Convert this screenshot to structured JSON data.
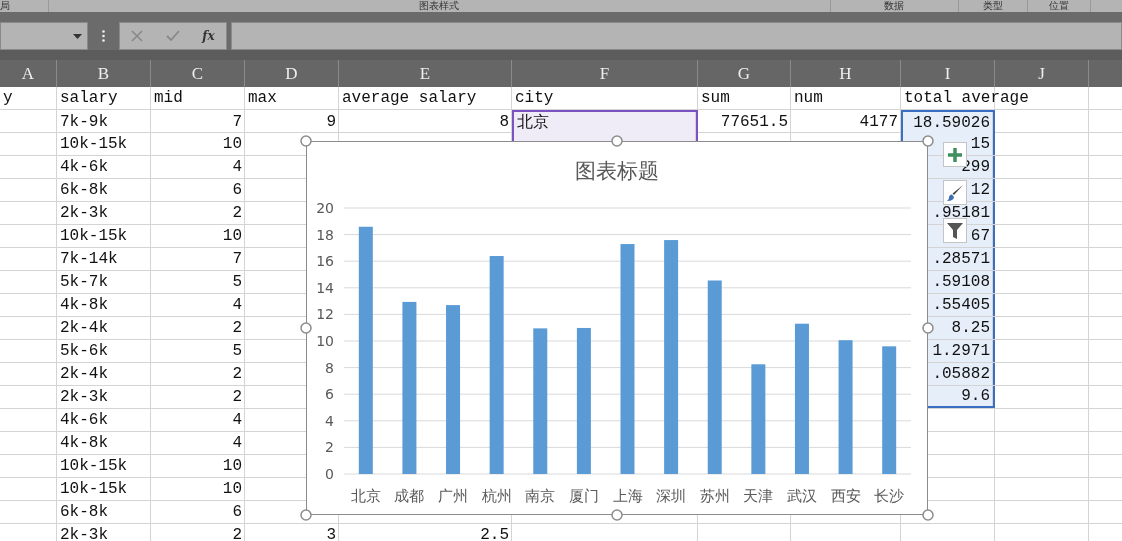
{
  "ribbon_groups": [
    {
      "label": "局"
    },
    {
      "label": "图表样式"
    },
    {
      "label": "数据"
    },
    {
      "label": "类型"
    },
    {
      "label": "位置"
    }
  ],
  "formula_bar": {
    "function_label": "fx"
  },
  "column_letters": [
    "A",
    "B",
    "C",
    "D",
    "E",
    "F",
    "G",
    "H",
    "I",
    "J"
  ],
  "header_row": [
    "y",
    "salary",
    "mid",
    "max",
    "average salary",
    "city",
    "sum",
    "num",
    "total average"
  ],
  "rows": [
    {
      "salary": "7k-9k",
      "mid": "7",
      "max": "9",
      "average_salary": "8",
      "city": "北京",
      "sum": "77651.5",
      "num": "4177",
      "total_average": "18.59026",
      "category_range": true,
      "value_range": true
    },
    {
      "salary": "10k-15k",
      "mid": "10",
      "total_average": "15",
      "category_range": true,
      "value_range": true
    },
    {
      "salary": "4k-6k",
      "mid": "4",
      "total_average": "299",
      "value_range": true
    },
    {
      "salary": "6k-8k",
      "mid": "6",
      "total_average": "12",
      "value_range": true
    },
    {
      "salary": "2k-3k",
      "mid": "2",
      "total_average": ".95181",
      "value_range": true
    },
    {
      "salary": "10k-15k",
      "mid": "10",
      "total_average": "67",
      "value_range": true
    },
    {
      "salary": "7k-14k",
      "mid": "7",
      "total_average": ".28571",
      "value_range": true
    },
    {
      "salary": "5k-7k",
      "mid": "5",
      "total_average": ".59108",
      "value_range": true
    },
    {
      "salary": "4k-8k",
      "mid": "4",
      "total_average": ".55405",
      "value_range": true
    },
    {
      "salary": "2k-4k",
      "mid": "2",
      "total_average": "8.25",
      "value_range": true
    },
    {
      "salary": "5k-6k",
      "mid": "5",
      "total_average": "1.2971",
      "value_range": true
    },
    {
      "salary": "2k-4k",
      "mid": "2",
      "total_average": ".05882",
      "value_range": true
    },
    {
      "salary": "2k-3k",
      "mid": "2",
      "total_average": "9.6",
      "value_range": true
    },
    {
      "salary": "4k-6k",
      "mid": "4"
    },
    {
      "salary": "4k-8k",
      "mid": "4"
    },
    {
      "salary": "10k-15k",
      "mid": "10"
    },
    {
      "salary": "10k-15k",
      "mid": "10"
    },
    {
      "salary": "6k-8k",
      "mid": "6"
    },
    {
      "salary": "2k-3k",
      "mid": "2",
      "max": "3",
      "average_salary": "2.5"
    }
  ],
  "chart": {
    "chart_data": {
      "type": "bar",
      "title": "图表标题",
      "categories": [
        "北京",
        "成都",
        "广州",
        "杭州",
        "南京",
        "厦门",
        "上海",
        "深圳",
        "苏州",
        "天津",
        "武汉",
        "西安",
        "长沙"
      ],
      "series": [
        {
          "color": "#5b9bd5",
          "values": [
            18.59,
            12.94,
            12.7,
            16.39,
            10.95,
            10.98,
            17.29,
            17.59,
            14.55,
            8.25,
            11.3,
            10.06,
            9.6
          ]
        }
      ],
      "grid": true,
      "ylim": [
        0,
        20
      ],
      "yticks": [
        0,
        2,
        4,
        6,
        8,
        10,
        12,
        14,
        16,
        18,
        20
      ]
    }
  }
}
